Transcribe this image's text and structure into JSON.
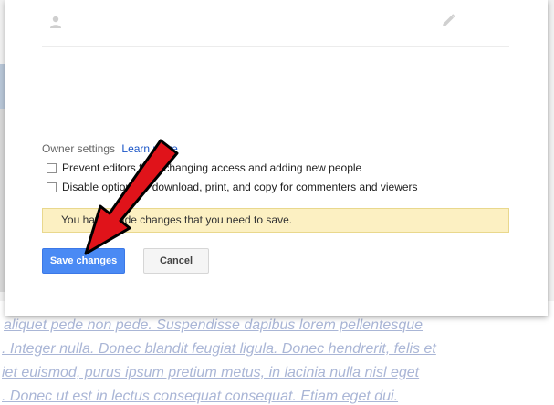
{
  "owner_settings": {
    "label": "Owner settings",
    "learn_more": "Learn more"
  },
  "options": [
    {
      "label": "Prevent editors from changing access and adding new people",
      "checked": false
    },
    {
      "label": "Disable options to download, print, and copy for commenters and viewers",
      "checked": false
    }
  ],
  "notice": "You have made changes that you need to save.",
  "buttons": {
    "save": "Save changes",
    "cancel": "Cancel"
  },
  "background_text": [
    "aliquet pede non pede. Suspendisse dapibus lorem pellentesque",
    ". Integer nulla. Donec blandit feugiat ligula. Donec hendrerit, felis et",
    "iet euismod, purus ipsum pretium metus, in lacinia nulla nisl eget",
    ". Donec ut est in lectus consequat consequat. Etiam eget dui."
  ],
  "colors": {
    "save_button": "#4a8af4",
    "notice_bg": "#fcf0c2",
    "link": "#1a55c7",
    "arrow": "#e0131a"
  },
  "icons": {
    "user": "person-icon",
    "edit": "pencil-icon",
    "annotation": "red-arrow"
  }
}
